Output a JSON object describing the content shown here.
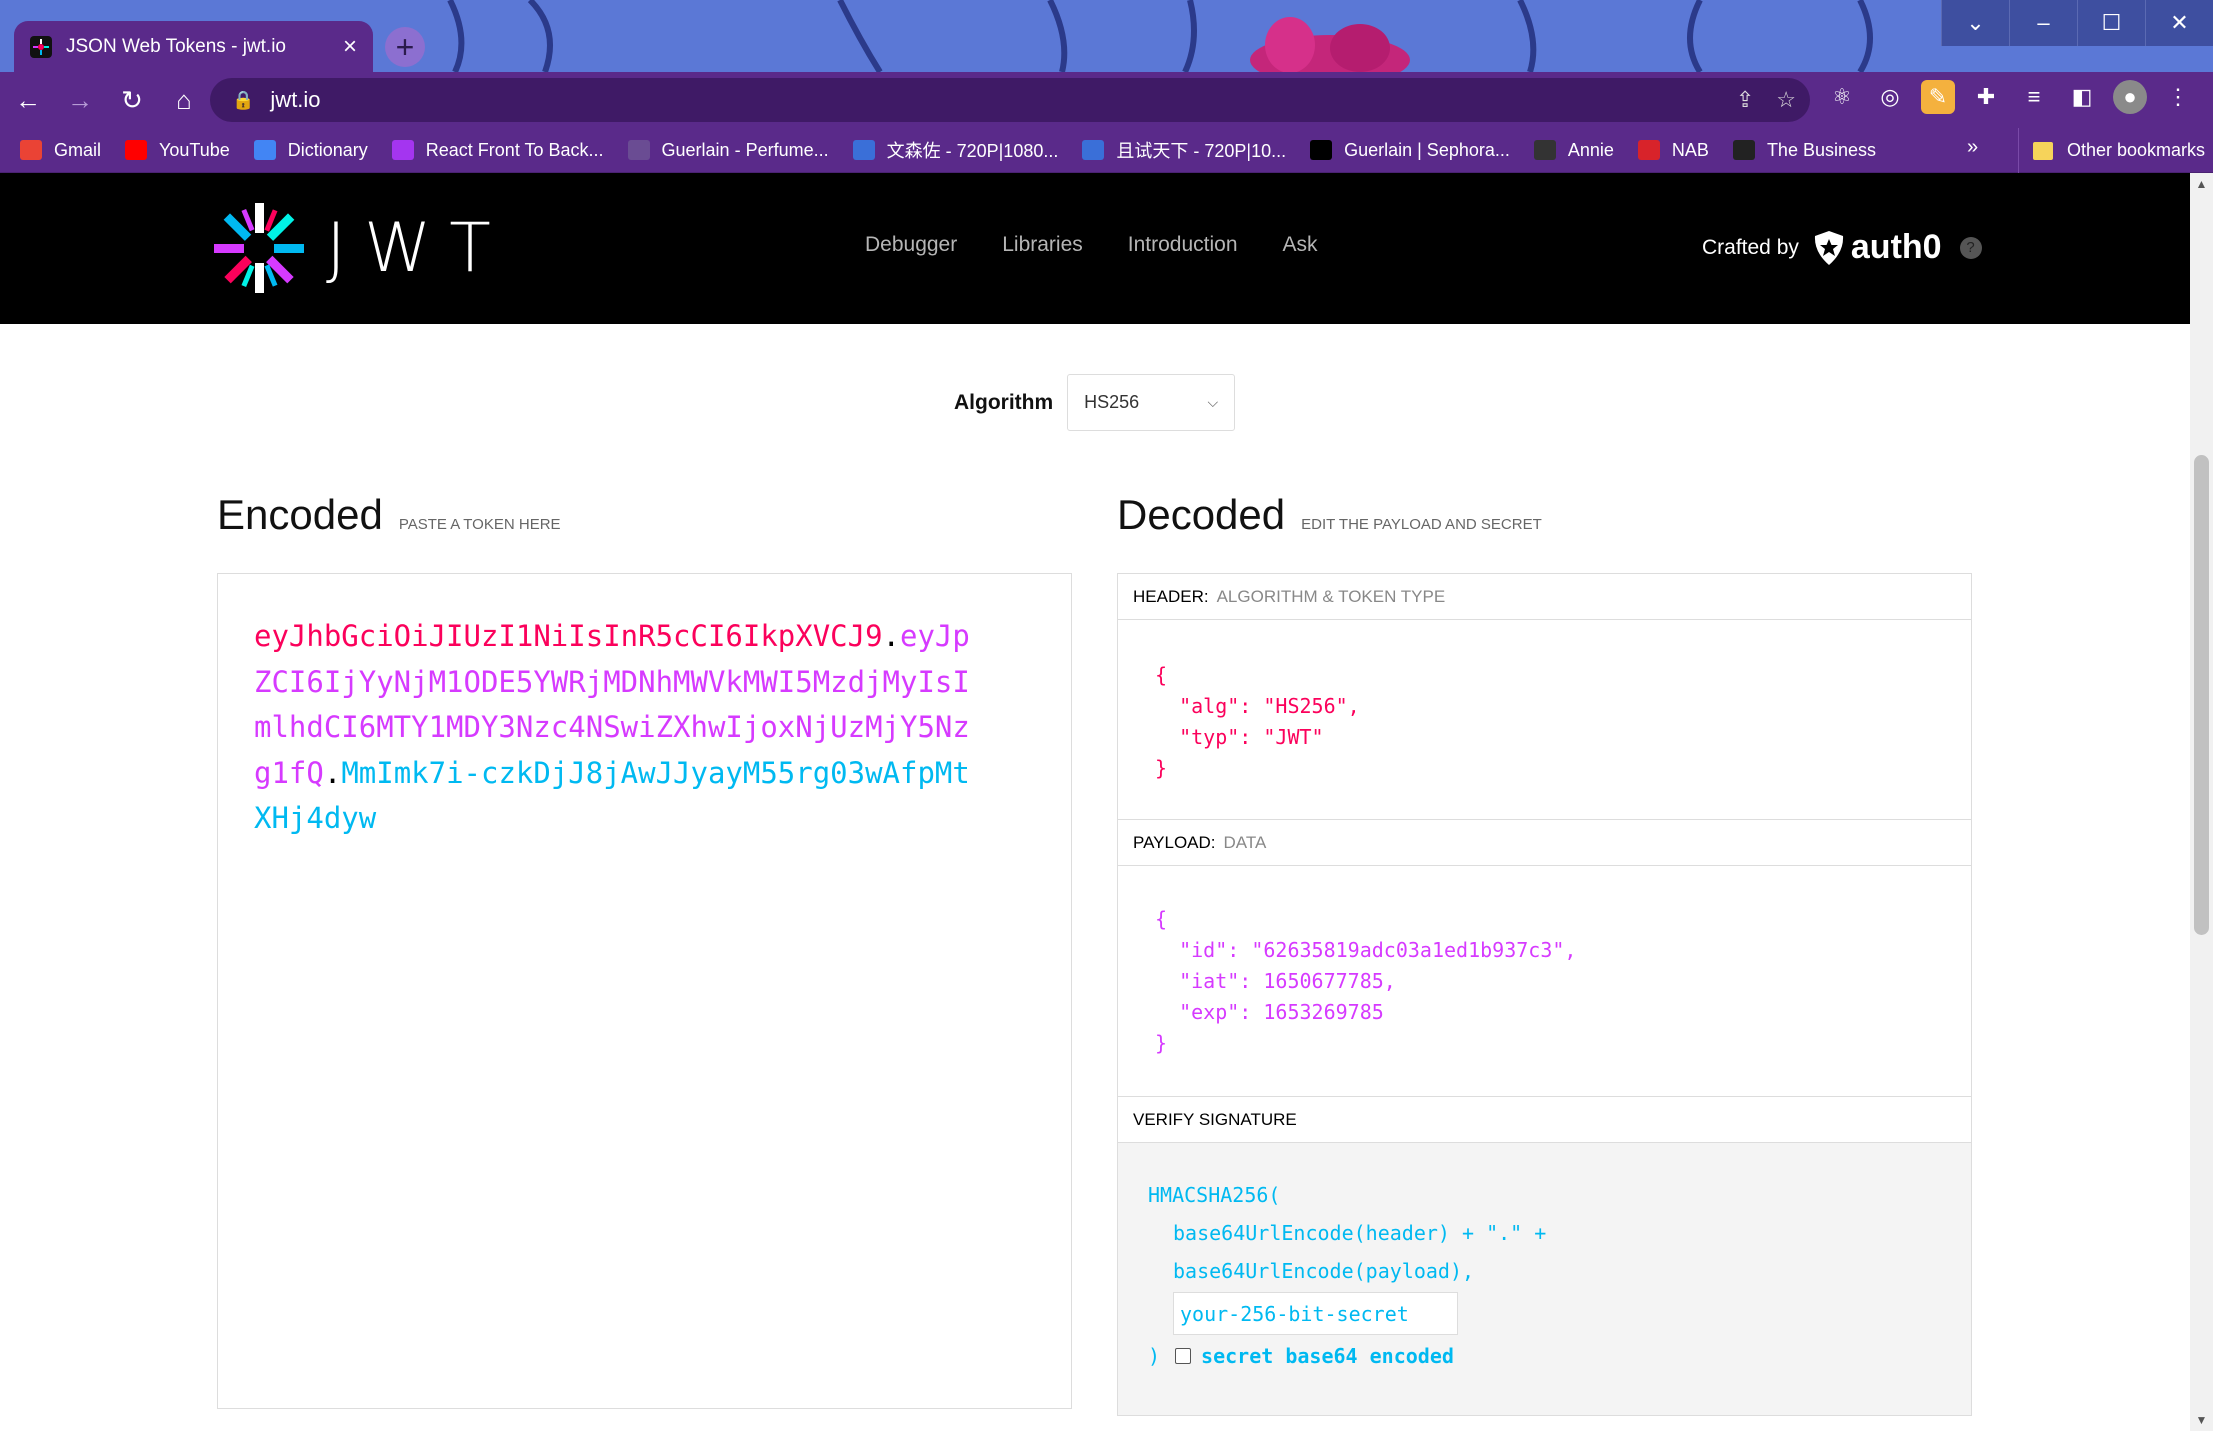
{
  "browser": {
    "tab_title": "JSON Web Tokens - jwt.io",
    "url": "jwt.io",
    "bookmarks": [
      {
        "label": "Gmail",
        "icon": "gmail-icon",
        "color": "#ea4335"
      },
      {
        "label": "YouTube",
        "icon": "youtube-icon",
        "color": "#ff0000"
      },
      {
        "label": "Dictionary",
        "icon": "google-icon",
        "color": "#4285f4"
      },
      {
        "label": "React Front To Back...",
        "icon": "udemy-icon",
        "color": "#a435f0"
      },
      {
        "label": "Guerlain - Perfume...",
        "icon": "guerlain-icon",
        "color": "#6a4c93"
      },
      {
        "label": "文森佐 - 720P|1080...",
        "icon": "video-site-icon",
        "color": "#3a6fd8"
      },
      {
        "label": "且试天下 - 720P|10...",
        "icon": "video-site-icon",
        "color": "#3a6fd8"
      },
      {
        "label": "Guerlain | Sephora...",
        "icon": "sephora-icon",
        "color": "#000000"
      },
      {
        "label": "Annie",
        "icon": "github-icon",
        "color": "#333333"
      },
      {
        "label": "NAB",
        "icon": "nab-icon",
        "color": "#d8232a"
      },
      {
        "label": "The Business",
        "icon": "abc-icon",
        "color": "#222222"
      }
    ],
    "more_bookmarks": "»",
    "other_bookmarks": "Other bookmarks"
  },
  "site": {
    "logo_text": "JWT",
    "nav": [
      "Debugger",
      "Libraries",
      "Introduction",
      "Ask"
    ],
    "crafted_by": "Crafted by",
    "brand": "auth0",
    "help": "?"
  },
  "algorithm": {
    "label": "Algorithm",
    "selected": "HS256"
  },
  "encoded": {
    "title": "Encoded",
    "subtitle": "PASTE A TOKEN HERE",
    "header_part": "eyJhbGciOiJIUzI1NiIsInR5cCI6IkpXVCJ9",
    "dot": ".",
    "payload_part": "eyJpZCI6IjYyNjM1ODE5YWRjMDNhMWVkMWI5MzdjMyIsImlhdCI6MTY1MDY3Nzc4NSwiZXhwIjoxNjUzMjY5Nzg1fQ",
    "signature_part": "MmImk7i-czkDjJ8jAwJJyayM55rg03wAfpMtXHj4dyw"
  },
  "decoded": {
    "title": "Decoded",
    "subtitle": "EDIT THE PAYLOAD AND SECRET",
    "header_label": "HEADER:",
    "header_hint": "ALGORITHM & TOKEN TYPE",
    "header_json": [
      "{",
      "  \"alg\": \"HS256\",",
      "  \"typ\": \"JWT\"",
      "}"
    ],
    "payload_label": "PAYLOAD:",
    "payload_hint": "DATA",
    "payload_json": [
      "{",
      "  \"id\": \"62635819adc03a1ed1b937c3\",",
      "  \"iat\": 1650677785,",
      "  \"exp\": 1653269785",
      "}"
    ],
    "verify_label": "VERIFY SIGNATURE",
    "sig_func": "HMACSHA256(",
    "sig_line1": "base64UrlEncode(header) + \".\" +",
    "sig_line2": "base64UrlEncode(payload),",
    "secret_placeholder": "your-256-bit-secret",
    "close_paren": ")",
    "checkbox_label": "secret base64 encoded"
  },
  "colors": {
    "header": "#fb015b",
    "payload": "#d63aff",
    "signature": "#00b9f1",
    "chrome": "#5a2a8a"
  }
}
